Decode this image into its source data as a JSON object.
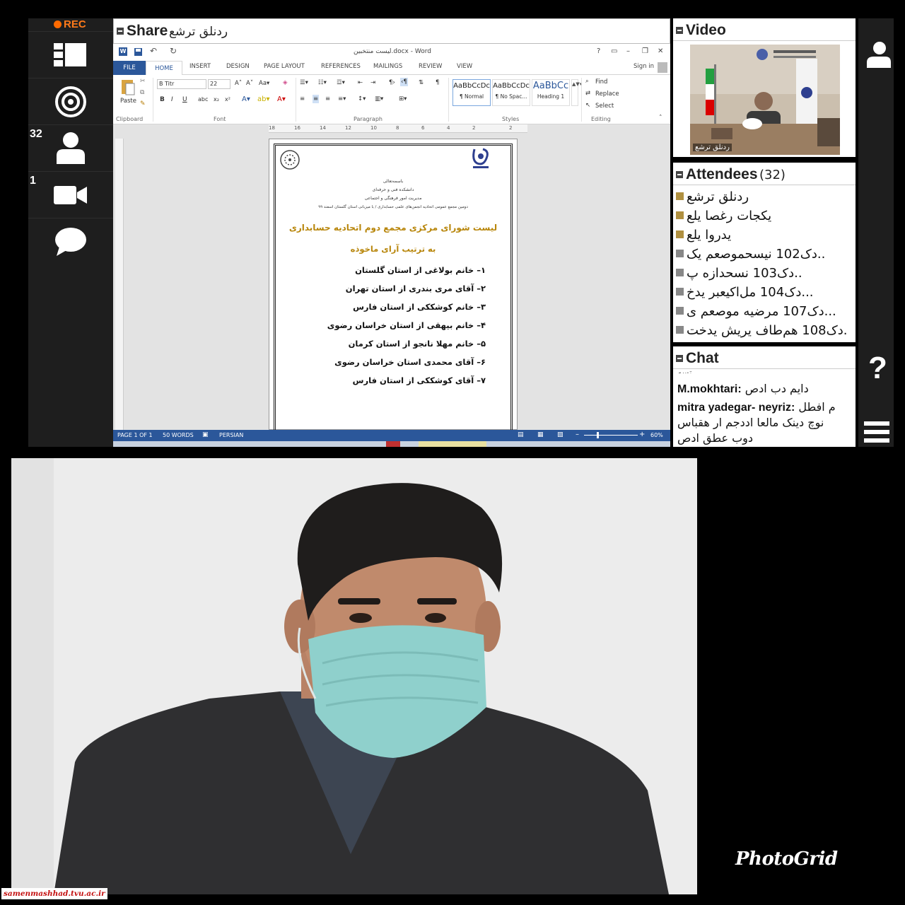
{
  "toolbar_left": {
    "rec_label": "REC",
    "attendees_count": "32",
    "camera_count": "1",
    "icons": [
      "layout-icon",
      "share-target-icon",
      "attendees-icon",
      "camera-icon",
      "chat-bubble-icon"
    ]
  },
  "share_pod": {
    "title": "Share",
    "presenter": "ردنلق ترشع"
  },
  "word": {
    "title": "لیست منتخبین.docx - Word",
    "window_controls": [
      "?",
      "▭",
      "–",
      "❐",
      "✕"
    ],
    "tabs": [
      "FILE",
      "HOME",
      "INSERT",
      "DESIGN",
      "PAGE LAYOUT",
      "REFERENCES",
      "MAILINGS",
      "REVIEW",
      "VIEW"
    ],
    "sign_in": "Sign in",
    "ribbon": {
      "paste_label": "Paste",
      "clipboard_label": "Clipboard",
      "font_name": "B Titr",
      "font_size": "22",
      "font_label": "Font",
      "paragraph_label": "Paragraph",
      "styles_label": "Styles",
      "editing_label": "Editing",
      "styles": [
        {
          "preview": "AaBbCcDc",
          "name": "¶ Normal"
        },
        {
          "preview": "AaBbCcDc",
          "name": "¶ No Spac..."
        },
        {
          "preview": "AaBbCc",
          "name": "Heading 1"
        }
      ],
      "find_label": "Find",
      "replace_label": "Replace",
      "select_label": "Select"
    },
    "ruler_marks": [
      "18",
      "16",
      "14",
      "12",
      "10",
      "8",
      "6",
      "4",
      "2",
      "2"
    ],
    "document": {
      "header_small": [
        "باسمه‌تعالی",
        "دانشکده فنی و حرفه‌ای",
        "مدیریت امور فرهنگی و اجتماعی",
        "دومین مجمع عمومی اتحادیه انجمن‌های علمی حسابداری / با میزبانی استان گلستان اسفند ۹۹"
      ],
      "title": "لیست شورای مرکزی مجمع دوم اتحادیه حسابداری",
      "subtitle": "به ترتیب آرای ماخوذه",
      "items": [
        "۱– خانم بولاغی از استان گلستان",
        "۲– آقای مری بندری از استان تهران",
        "۳– خانم کوشککی از استان فارس",
        "۴– خانم بیهقی از استان خراسان رضوی",
        "۵– خانم مهلا نانجو از استان کرمان",
        "۶– آقای محمدی استان خراسان رضوی",
        "۷– آقای کوشککی از استان فارس"
      ]
    },
    "status": {
      "page": "PAGE 1 OF 1",
      "words": "50 WORDS",
      "language": "PERSIAN",
      "zoom": "60%"
    }
  },
  "video_pod": {
    "title": "Video",
    "caption": "ردنلق ترشع"
  },
  "attendees_pod": {
    "title": "Attendees",
    "count": "(32)",
    "list": [
      "ردنلق ترشع",
      "یکجات رغصا یلع",
      "یدروا یلع",
      "دک102 نیسحموصعم یک..",
      "دک103 نسحدازه  پ..",
      "دک104 مل‌اکیعبر یدخ...",
      "دک107 مرضیه موصعم ی...",
      "دک108 هم‌طاف یریش یدخت."
    ]
  },
  "chat_pod": {
    "title": "Chat",
    "partial_top": "تسه",
    "messages": [
      {
        "user": "M.mokhtari:",
        "text": "دایم دب ادص"
      },
      {
        "user": "mitra yadegar- neyriz:",
        "text": "م افطل"
      },
      {
        "user": "",
        "text": "نوچ دینک مالعا اددجم ار هقباس"
      },
      {
        "user": "",
        "text": "دوب عطق ادص"
      }
    ]
  },
  "photo": {
    "watermark": "PhotoGrid",
    "site": "samenmashhad.tvu.ac.ir"
  },
  "colors": {
    "word_blue": "#2b579a",
    "rec_orange": "#ff7a1a",
    "mask": "#8fd0cc",
    "title_gold": "#b8860b",
    "site_red": "#c41010"
  }
}
